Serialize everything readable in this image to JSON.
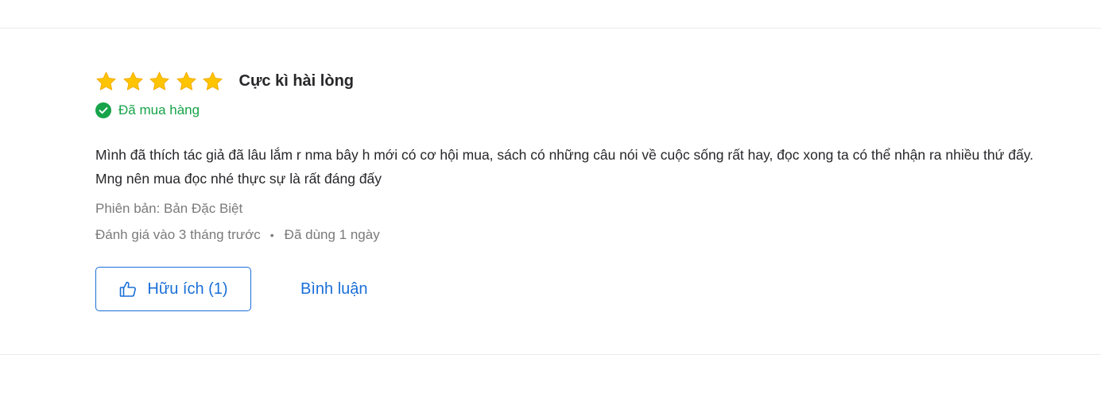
{
  "review": {
    "rating": 5,
    "rating_max": 5,
    "star_color": "#ffc400",
    "title": "Cực kì hài lòng",
    "purchased_label": "Đã mua hàng",
    "purchased_color": "#17a34a",
    "content": "Mình đã thích tác giả đã lâu lắm r nma bây h mới có cơ hội mua, sách có những câu nói về cuộc sống rất hay, đọc xong ta có thể nhận ra nhiều thứ đấy. Mng nên mua đọc nhé thực sự là rất đáng đấy",
    "variant": "Phiên bản: Bản Đặc Biệt",
    "review_time": "Đánh giá vào 3 tháng trước",
    "separator": "•",
    "usage": "Đã dùng 1 ngày"
  },
  "actions": {
    "helpful_label": "Hữu ích (1)",
    "helpful_icon": "thumbs-up-icon",
    "comment_label": "Bình luận",
    "accent_color": "#1a6fd8"
  }
}
